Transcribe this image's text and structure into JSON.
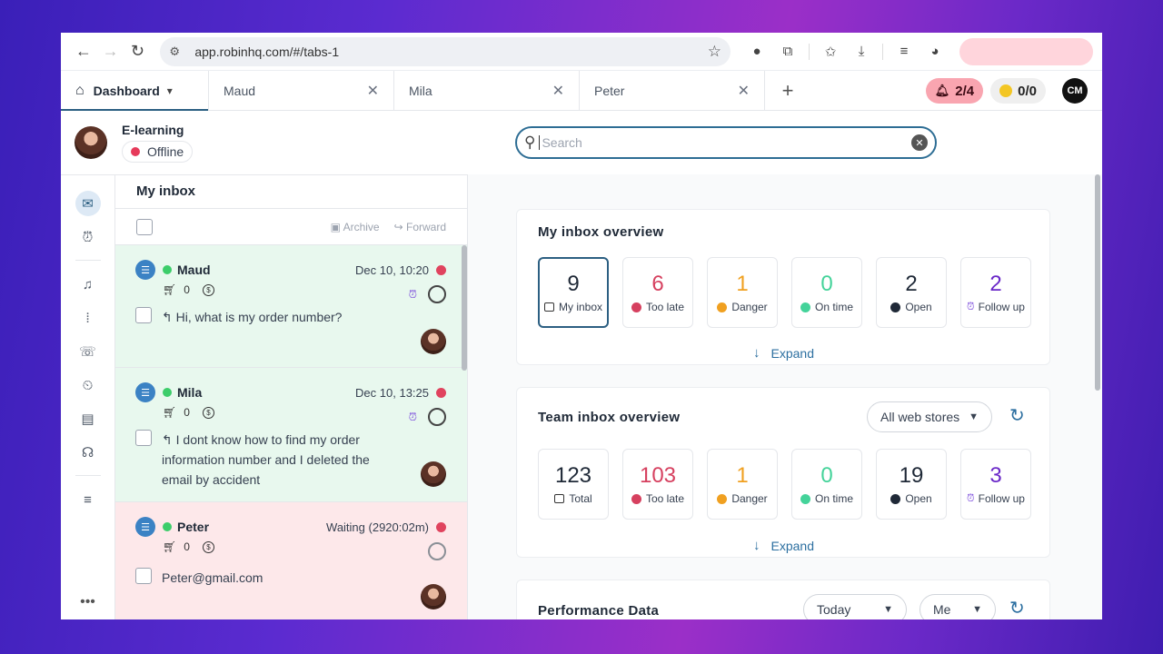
{
  "browser": {
    "url": "app.robinhq.com/#/tabs-1"
  },
  "tabs": {
    "dashboard": "Dashboard",
    "items": [
      "Maud",
      "Mila",
      "Peter"
    ],
    "notifications": "2/4",
    "coins": "0/0",
    "logo": "CM"
  },
  "user": {
    "name": "E-learning",
    "status": "Offline"
  },
  "search": {
    "placeholder": "Search",
    "value": ""
  },
  "inbox": {
    "title": "My inbox",
    "archive": "Archive",
    "forward": "Forward",
    "conversations": [
      {
        "name": "Maud",
        "time": "Dec 10, 10:20",
        "orders": "0",
        "message": "Hi, what is my order number?",
        "color": "green"
      },
      {
        "name": "Mila",
        "time": "Dec 10, 13:25",
        "orders": "0",
        "message": "I dont know how to find my order information number and I deleted the email by accident",
        "color": "green"
      },
      {
        "name": "Peter",
        "time": "Waiting (2920:02m)",
        "orders": "0",
        "message": "Peter@gmail.com",
        "color": "pink"
      }
    ]
  },
  "my_overview": {
    "title": "My inbox overview",
    "stats": [
      {
        "value": "9",
        "label": "My inbox",
        "color": "#1f2937"
      },
      {
        "value": "6",
        "label": "Too late",
        "color": "#d6405f"
      },
      {
        "value": "1",
        "label": "Danger",
        "color": "#f0a020"
      },
      {
        "value": "0",
        "label": "On time",
        "color": "#44d39a"
      },
      {
        "value": "2",
        "label": "Open",
        "color": "#1f2937"
      },
      {
        "value": "2",
        "label": "Follow up",
        "color": "#6a28c8"
      }
    ],
    "expand": "Expand"
  },
  "team_overview": {
    "title": "Team inbox overview",
    "filter": "All web stores",
    "stats": [
      {
        "value": "123",
        "label": "Total",
        "color": "#1f2937"
      },
      {
        "value": "103",
        "label": "Too late",
        "color": "#d6405f"
      },
      {
        "value": "1",
        "label": "Danger",
        "color": "#f0a020"
      },
      {
        "value": "0",
        "label": "On time",
        "color": "#44d39a"
      },
      {
        "value": "19",
        "label": "Open",
        "color": "#1f2937"
      },
      {
        "value": "3",
        "label": "Follow up",
        "color": "#6a28c8"
      }
    ],
    "expand": "Expand"
  },
  "performance": {
    "title": "Performance Data",
    "period": "Today",
    "who": "Me"
  },
  "colors": {
    "accent": "#2c5f82",
    "late": "#d6405f",
    "danger": "#f0a020",
    "ontime": "#44d39a",
    "followup": "#6a28c8"
  }
}
